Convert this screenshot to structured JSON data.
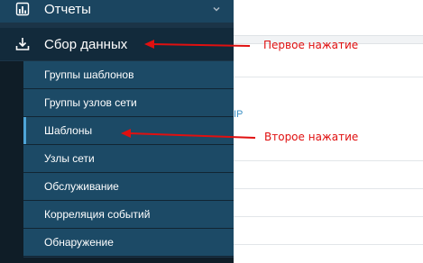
{
  "sidebar": {
    "top_items": [
      {
        "label": "Отчеты",
        "icon": "bar-chart-icon"
      },
      {
        "label": "Сбор данных",
        "icon": "download-icon"
      }
    ],
    "sub_items": [
      {
        "label": "Группы шаблонов"
      },
      {
        "label": "Группы узлов сети"
      },
      {
        "label": "Шаблоны",
        "active": true
      },
      {
        "label": "Узлы сети"
      },
      {
        "label": "Обслуживание"
      },
      {
        "label": "Корреляция событий"
      },
      {
        "label": "Обнаружение"
      }
    ]
  },
  "main": {
    "partial_link": "IP"
  },
  "annotations": {
    "first_click": "Первое нажатие",
    "second_click": "Второе нажатие",
    "color": "#e01010"
  },
  "colors": {
    "sidebar_bg": "#1b3447",
    "submenu_bg": "#1c4a66",
    "active_accent": "#4ea5d8",
    "link": "#3a8fc4"
  }
}
